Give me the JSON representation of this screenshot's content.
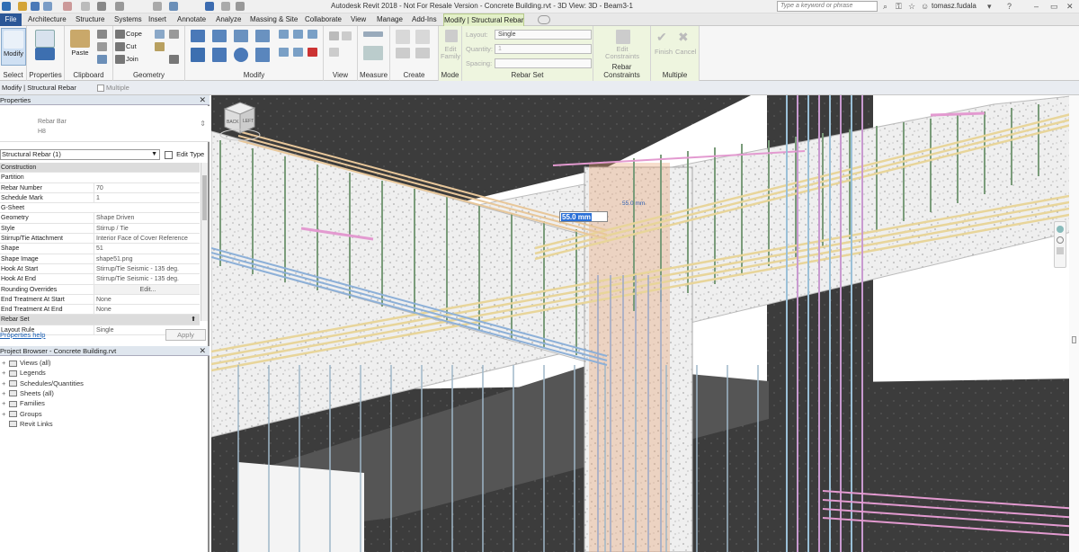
{
  "window": {
    "title": "Autodesk Revit 2018 - Not For Resale Version -     Concrete Building.rvt - 3D View: 3D - Beam3-1",
    "search_placeholder": "Type a keyword or phrase",
    "user": "tomasz.fudala"
  },
  "tabs": [
    "File",
    "Architecture",
    "Structure",
    "Systems",
    "Insert",
    "Annotate",
    "Analyze",
    "Massing & Site",
    "Collaborate",
    "View",
    "Manage",
    "Add-Ins",
    "Modify | Structural Rebar"
  ],
  "ribbon": {
    "select": {
      "button": "Modify",
      "label": "Select"
    },
    "properties": {
      "button": "Properties",
      "label": "Properties"
    },
    "clipboard": {
      "paste": "Paste",
      "label": "Clipboard"
    },
    "geometry": {
      "cope": "Cope",
      "cut": "Cut",
      "join": "Join",
      "label": "Geometry"
    },
    "modify": {
      "label": "Modify"
    },
    "view": {
      "label": "View"
    },
    "measure": {
      "label": "Measure"
    },
    "create": {
      "label": "Create"
    },
    "mode": {
      "edit_family": "Edit Family",
      "label": "Mode"
    },
    "rebar_set": {
      "layout_label": "Layout:",
      "layout_value": "Single",
      "quantity_label": "Quantity:",
      "quantity_value": "1",
      "spacing_label": "Spacing:",
      "label": "Rebar Set"
    },
    "rebar_constraints": {
      "edit": "Edit Constraints",
      "label": "Rebar Constraints"
    },
    "multiple": {
      "finish": "Finish",
      "cancel": "Cancel",
      "label": "Multiple"
    }
  },
  "options_bar": {
    "context": "Modify | Structural Rebar",
    "multiple": "Multiple"
  },
  "properties": {
    "title": "Properties",
    "type_name_1": "Rebar Bar",
    "type_name_2": "H8",
    "selector": "Structural Rebar (1)",
    "edit_type": "Edit Type",
    "rows": [
      {
        "k": "Construction",
        "v": "",
        "cat": true
      },
      {
        "k": "Partition",
        "v": ""
      },
      {
        "k": "Rebar Number",
        "v": "70"
      },
      {
        "k": "Schedule Mark",
        "v": "1"
      },
      {
        "k": "G-Sheet",
        "v": ""
      },
      {
        "k": "Geometry",
        "v": "Shape Driven"
      },
      {
        "k": "Style",
        "v": "Stirrup / Tie"
      },
      {
        "k": "Stirrup/Tie Attachment",
        "v": "Interior Face of Cover Reference"
      },
      {
        "k": "Shape",
        "v": "51"
      },
      {
        "k": "Shape Image",
        "v": "shape51.png"
      },
      {
        "k": "Hook At Start",
        "v": "Stirrup/Tie Seismic - 135 deg."
      },
      {
        "k": "Hook At End",
        "v": "Stirrup/Tie Seismic - 135 deg."
      },
      {
        "k": "Rounding Overrides",
        "v": "Edit..."
      },
      {
        "k": "End Treatment At Start",
        "v": "None"
      },
      {
        "k": "End Treatment At End",
        "v": "None"
      },
      {
        "k": "Rebar Set",
        "v": "",
        "cat": true
      },
      {
        "k": "Layout Rule",
        "v": "Single"
      }
    ],
    "help": "Properties help",
    "apply": "Apply"
  },
  "project_browser": {
    "title": "Project Browser - Concrete Building.rvt",
    "items": [
      "Views (all)",
      "Legends",
      "Schedules/Quantities",
      "Sheets (all)",
      "Families",
      "Groups",
      "Revit Links"
    ]
  },
  "viewport": {
    "dimension": "55.0 mm",
    "dimension_small": "55.0 mm",
    "viewcube_faces": [
      "BACK",
      "LEFT"
    ]
  }
}
